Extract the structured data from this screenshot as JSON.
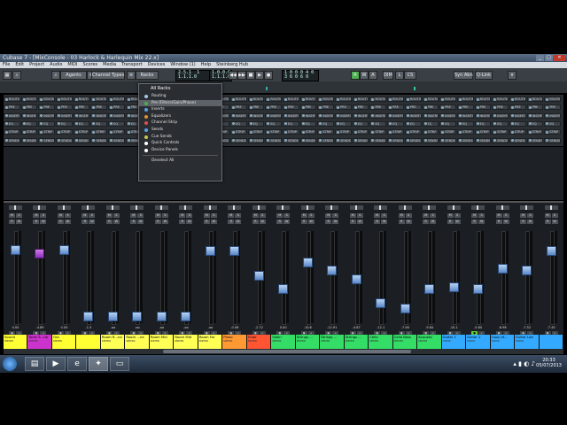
{
  "window": {
    "title": "Cubase 7 - [MixConsole - 03 Harlock & Harlequin Mix 22.x]",
    "min": "_",
    "max": "□",
    "close": "✕"
  },
  "menubar": [
    "File",
    "Edit",
    "Project",
    "Audio",
    "MIDI",
    "Scores",
    "Media",
    "Transport",
    "Devices",
    "Window (1)",
    "Help",
    "Steinberg Hub"
  ],
  "toolbar": {
    "agents_label": "Agents",
    "channel_types_label": "Channel Types",
    "racks_label": "Racks",
    "lcd_left": "2.5.1  1\n1.1.1.0",
    "lcd_mid": "1.0.0.0\n1.1.1.0",
    "lcd_right": "1 0 0 0 4 0\n3 6 0 6 0",
    "r_label": "R",
    "w_label": "W",
    "a_label": "A",
    "dim_label": "DIM",
    "l_label": "L",
    "cs_label": "CS",
    "sync_label": "Syn Abn",
    "qlink_label": "Q-Link"
  },
  "rack_rows": [
    {
      "label": "ROUTING",
      "color": "#8ab"
    },
    {
      "label": "PRE",
      "color": "#8ab"
    },
    {
      "label": "INSERTS",
      "color": "#8ab"
    },
    {
      "label": "EQ",
      "color": "#8ab"
    },
    {
      "label": "STRIP",
      "color": "#8ab"
    },
    {
      "label": "SENDS",
      "color": "#8ab"
    }
  ],
  "racks_menu": {
    "header": "All Racks",
    "items": [
      {
        "label": "Routing",
        "color": "#a9c7e8",
        "selected": false
      },
      {
        "label": "Pre (Filters/Gain/Phase)",
        "color": "#4caf50",
        "selected": true
      },
      {
        "label": "Inserts",
        "color": "#5aa0e6",
        "selected": false
      },
      {
        "label": "Equalizers",
        "color": "#e09030",
        "selected": false
      },
      {
        "label": "Channel Strip",
        "color": "#e05050",
        "selected": false
      },
      {
        "label": "Sends",
        "color": "#5aa0e6",
        "selected": false
      },
      {
        "label": "Cue Sends",
        "color": "#c8c850",
        "selected": false
      },
      {
        "label": "Quick Controls",
        "color": "#ffffff",
        "selected": false
      },
      {
        "label": "Device Panels",
        "color": "#ffffff",
        "selected": false
      }
    ],
    "footer": "Deselect All"
  },
  "channels": [
    {
      "num": "18",
      "name": "Sound",
      "type": "stereo",
      "color": "#ffff33",
      "vol": "0.00",
      "fader": 0.83,
      "purple": false,
      "active": false
    },
    {
      "num": "19",
      "name": "Tonic S...ne",
      "type": "stereo",
      "color": "#cc33cc",
      "vol": "-4.89",
      "fader": 0.78,
      "purple": true,
      "active": false
    },
    {
      "num": "20",
      "name": "Oro",
      "type": "stereo",
      "color": "#ffff33",
      "vol": "0.00",
      "fader": 0.83,
      "purple": false,
      "active": false
    },
    {
      "num": "21",
      "name": "",
      "type": "",
      "color": "#ffff33",
      "vol": "-1.5",
      "fader": 0.02,
      "purple": false,
      "active": false
    },
    {
      "num": "22",
      "name": "Room R...ne",
      "type": "stereo",
      "color": "#ffff55",
      "vol": "-oo",
      "fader": 0.02,
      "purple": false,
      "active": false
    },
    {
      "num": "23",
      "name": "Room ...ne",
      "type": "stereo",
      "color": "#ffff55",
      "vol": "-oo",
      "fader": 0.02,
      "purple": false,
      "active": false
    },
    {
      "num": "24",
      "name": "Room Mid",
      "type": "stereo",
      "color": "#ffff55",
      "vol": "-oo",
      "fader": 0.02,
      "purple": false,
      "active": false
    },
    {
      "num": "25",
      "name": "Room Mid",
      "type": "stereo",
      "color": "#ffff55",
      "vol": "-oo",
      "fader": 0.02,
      "purple": false,
      "active": false
    },
    {
      "num": "26",
      "name": "Room Far",
      "type": "stereo",
      "color": "#ffff55",
      "vol": "-oo",
      "fader": 0.82,
      "purple": false,
      "active": false
    },
    {
      "num": "27",
      "name": "Piano",
      "type": "stereo",
      "color": "#ff9933",
      "vol": "-0.56",
      "fader": 0.82,
      "purple": false,
      "active": false
    },
    {
      "num": "28",
      "name": "Choir",
      "type": "stereo",
      "color": "#ff5533",
      "vol": "-2.72",
      "fader": 0.52,
      "purple": false,
      "active": false
    },
    {
      "num": "29",
      "name": "Violin",
      "type": "stereo",
      "color": "#33dd66",
      "vol": "0.00",
      "fader": 0.35,
      "purple": false,
      "active": false
    },
    {
      "num": "30",
      "name": "Strings ...",
      "type": "stereo",
      "color": "#33dd66",
      "vol": "-10.6",
      "fader": 0.68,
      "purple": false,
      "active": false
    },
    {
      "num": "31",
      "name": "Strings ...",
      "type": "stereo",
      "color": "#33dd66",
      "vol": "-12.91",
      "fader": 0.58,
      "purple": false,
      "active": false
    },
    {
      "num": "32",
      "name": "Strings ...",
      "type": "stereo",
      "color": "#33dd66",
      "vol": "-4.87",
      "fader": 0.47,
      "purple": false,
      "active": false
    },
    {
      "num": "33",
      "name": "Cello",
      "type": "stereo",
      "color": "#33dd66",
      "vol": "-12.1",
      "fader": 0.18,
      "purple": false,
      "active": false
    },
    {
      "num": "34",
      "name": "Cello Bass",
      "type": "stereo",
      "color": "#33dd66",
      "vol": "-7.06",
      "fader": 0.12,
      "purple": false,
      "active": false
    },
    {
      "num": "35",
      "name": "Acoustic",
      "type": "stereo",
      "color": "#33dd66",
      "vol": "-9.84",
      "fader": 0.36,
      "purple": false,
      "active": false
    },
    {
      "num": "36",
      "name": "Guitar 1",
      "type": "mono",
      "color": "#33aaff",
      "vol": "-10.1",
      "fader": 0.38,
      "purple": false,
      "active": false
    },
    {
      "num": "37",
      "name": "Guitar 2",
      "type": "mono",
      "color": "#33aaff",
      "vol": "-5.60",
      "fader": 0.36,
      "purple": false,
      "active": true
    },
    {
      "num": "38",
      "name": "Copy of...",
      "type": "mono",
      "color": "#33aaff",
      "vol": "-8.98",
      "fader": 0.6,
      "purple": false,
      "active": false
    },
    {
      "num": "39",
      "name": "Guitar Lea",
      "type": "mono",
      "color": "#33aaff",
      "vol": "-7.52",
      "fader": 0.58,
      "purple": false,
      "active": false
    },
    {
      "num": "40",
      "name": "",
      "type": "",
      "color": "#33aaff",
      "vol": "-7.45",
      "fader": 0.82,
      "purple": false,
      "active": false
    },
    {
      "num": "41",
      "name": "",
      "type": "",
      "color": "#33aaff",
      "vol": "-3.16",
      "fader": 0.82,
      "purple": false,
      "active": false
    },
    {
      "num": "42",
      "name": "",
      "type": "",
      "color": "#33aaff",
      "vol": "-5.3",
      "fader": 0.82,
      "purple": false,
      "active": false
    },
    {
      "num": "43",
      "name": "",
      "type": "",
      "color": "#33aaff",
      "vol": "-1.44",
      "fader": 0.45,
      "purple": false,
      "active": false
    },
    {
      "num": "44",
      "name": "",
      "type": "",
      "color": "#33aaff",
      "vol": "-1.84",
      "fader": 0.7,
      "purple": false,
      "active": false
    },
    {
      "num": "45",
      "name": "",
      "type": "",
      "color": "#33aaff",
      "vol": "-1.47",
      "fader": 0.52,
      "purple": false,
      "active": false
    },
    {
      "num": "46",
      "name": "",
      "type": "",
      "color": "#33aaff",
      "vol": "-3.96",
      "fader": 0.82,
      "purple": false,
      "active": false
    },
    {
      "num": "47",
      "name": "Tempo ...",
      "type": "stereo",
      "color": "#ff9999",
      "vol": "-3.97",
      "fader": 0.82,
      "purple": false,
      "active": false
    },
    {
      "num": "48",
      "name": "Tempo ...",
      "type": "stereo",
      "color": "#ff9999",
      "vol": "-16.3",
      "fader": 0.82,
      "purple": false,
      "active": false
    }
  ],
  "taskbar": {
    "time": "20:33",
    "date": "05/07/2013"
  }
}
